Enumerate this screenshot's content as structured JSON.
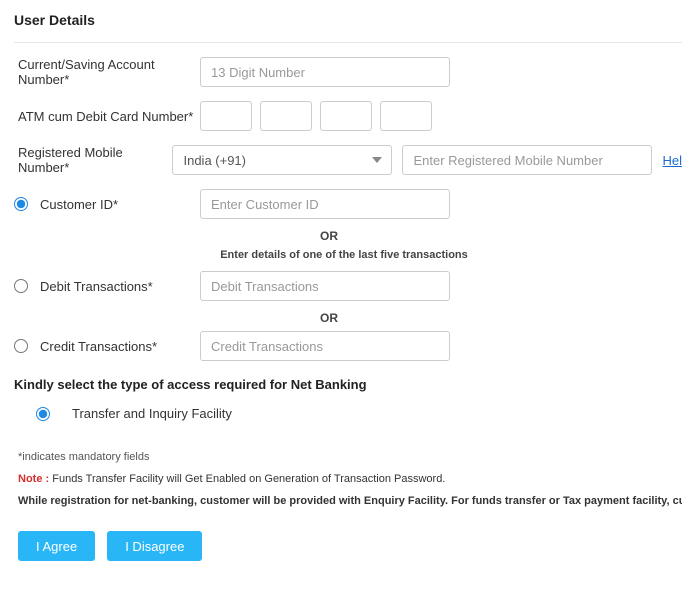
{
  "title": "User Details",
  "fields": {
    "account_label": "Current/Saving Account Number*",
    "account_placeholder": "13 Digit Number",
    "atm_label": "ATM cum Debit Card Number*",
    "mobile_label": "Registered Mobile Number*",
    "country_code": "India (+91)",
    "mobile_placeholder": "Enter Registered Mobile Number",
    "help_text": "Hel",
    "customer_id_label": "Customer ID*",
    "customer_id_placeholder": "Enter Customer ID",
    "or_text": "OR",
    "txn_hint": "Enter details of one of the last five transactions",
    "debit_label": "Debit Transactions*",
    "debit_placeholder": "Debit Transactions",
    "credit_label": "Credit Transactions*",
    "credit_placeholder": "Credit Transactions"
  },
  "access": {
    "title": "Kindly select the type of access required for Net Banking",
    "option": "Transfer and Inquiry Facility"
  },
  "notes": {
    "mandatory": "*indicates mandatory fields",
    "note_label": "Note : ",
    "note_body": "Funds Transfer Facility will Get Enabled on Generation of Transaction Password.",
    "long": "While registration for net-banking, customer will be provided with Enquiry Facility. For funds transfer or Tax payment facility, customer has to get a tran"
  },
  "buttons": {
    "agree": "I Agree",
    "disagree": "I Disagree"
  }
}
